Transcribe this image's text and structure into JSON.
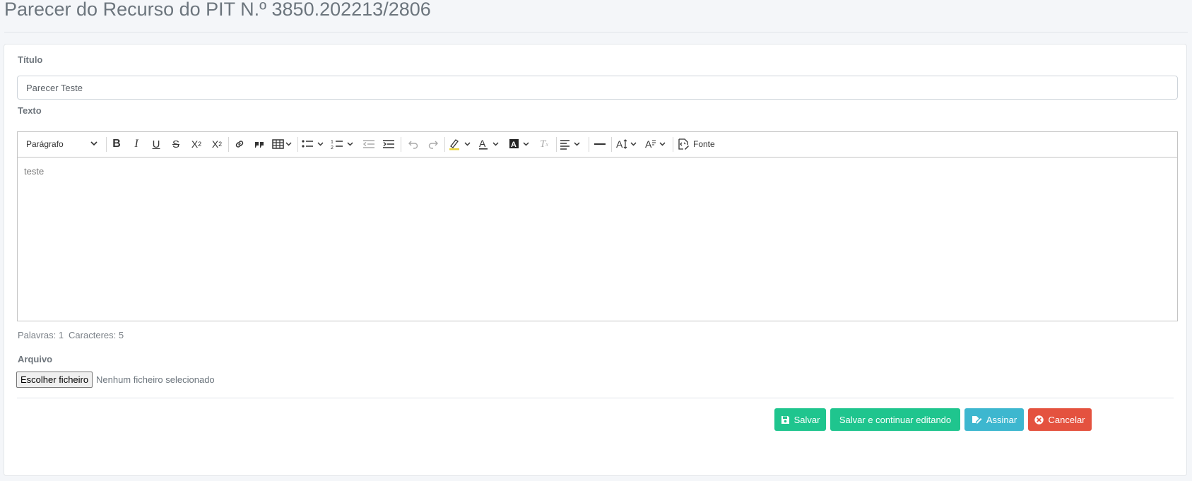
{
  "page": {
    "title": "Parecer do Recurso do PIT N.º 3850.202213/2806"
  },
  "form": {
    "title_label": "Título",
    "title_value": "Parecer Teste",
    "text_label": "Texto",
    "file_label": "Arquivo",
    "file_button": "Escolher ficheiro",
    "file_status": "Nenhum ficheiro selecionado"
  },
  "editor": {
    "paragraph_select": "Parágrafo",
    "source_label": "Fonte",
    "content": "teste",
    "words_label": "Palavras: 1",
    "chars_label": "Caracteres: 5"
  },
  "actions": {
    "save": "Salvar",
    "save_continue": "Salvar e continuar editando",
    "sign": "Assinar",
    "cancel": "Cancelar"
  },
  "colors": {
    "success": "#1fc58e",
    "info": "#3db7cf",
    "danger": "#e4523f"
  }
}
